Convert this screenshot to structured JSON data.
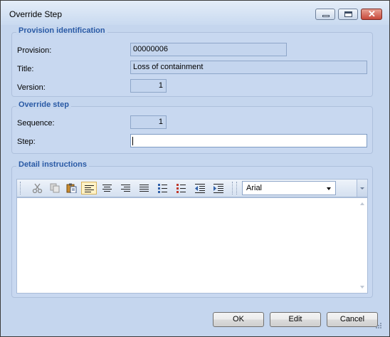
{
  "window": {
    "title": "Override Step"
  },
  "provision": {
    "group_title": "Provision identification",
    "provision_label": "Provision:",
    "provision_value": "00000006",
    "title_label": "Title:",
    "title_value": "Loss of containment",
    "version_label": "Version:",
    "version_value": "1"
  },
  "override": {
    "group_title": "Override step",
    "sequence_label": "Sequence:",
    "sequence_value": "1",
    "step_label": "Step:",
    "step_value": ""
  },
  "details": {
    "group_title": "Detail instructions",
    "font": "Arial",
    "editor_text": ""
  },
  "buttons": {
    "ok": "OK",
    "edit": "Edit",
    "cancel": "Cancel"
  },
  "colors": {
    "group_title": "#2a5aa5",
    "background": "#c5d6ee",
    "close_button": "#c7483a"
  },
  "icons": [
    "cut-icon",
    "copy-icon",
    "paste-icon",
    "align-left-icon",
    "align-center-icon",
    "align-right-icon",
    "justify-icon",
    "bullet-list-icon",
    "numbered-list-icon",
    "outdent-icon",
    "indent-icon"
  ]
}
